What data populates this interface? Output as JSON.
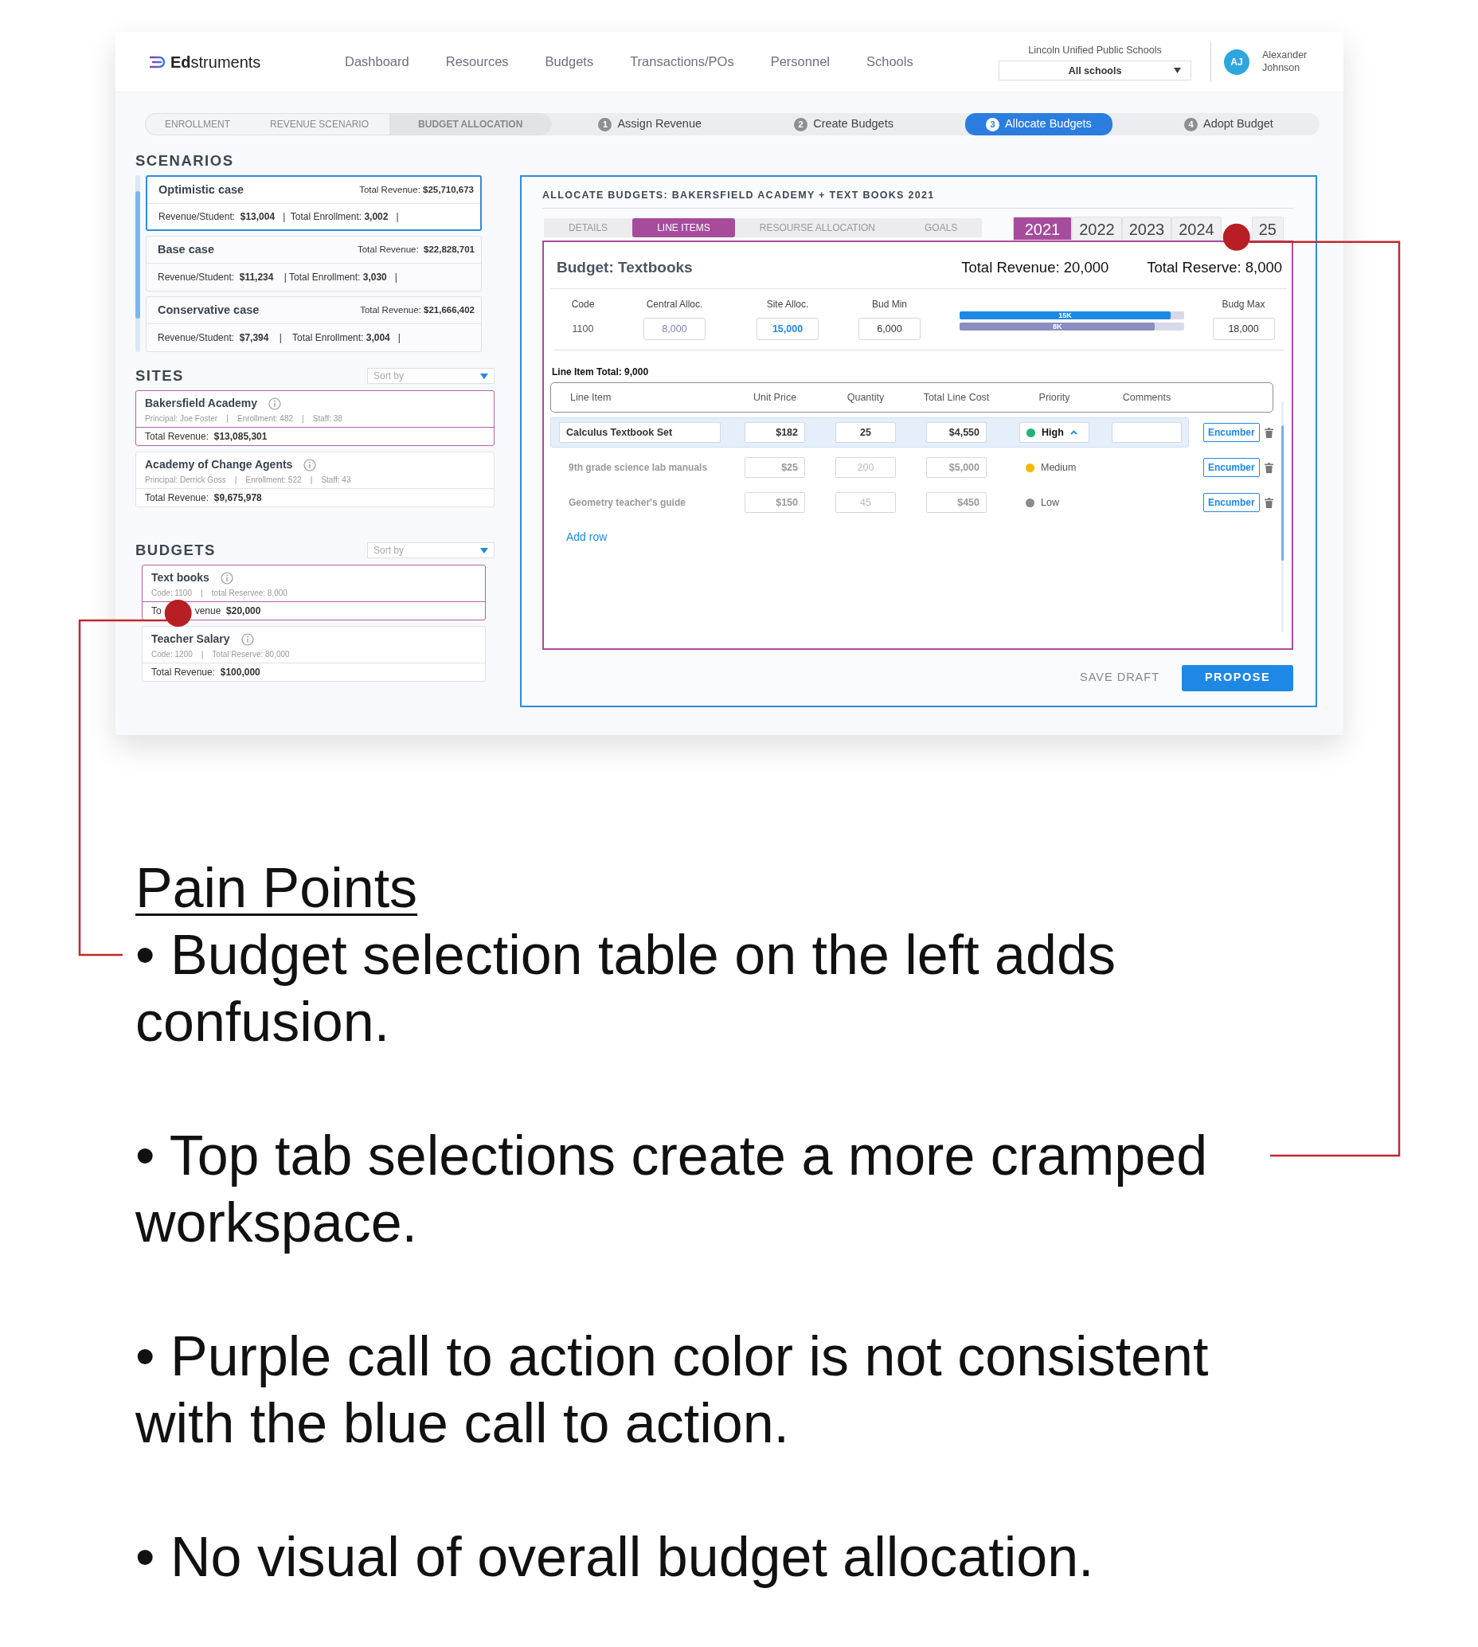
{
  "app": {
    "logo": "**Ed**struments",
    "nav": [
      "Dashboard",
      "Resources",
      "Budgets",
      "Transactions/POs",
      "Personnel",
      "Schools"
    ],
    "district": "Lincoln Unified Public Schools",
    "school_select": "All schools",
    "user": {
      "initials": "AJ",
      "name": "Alexander Johnson"
    }
  },
  "stepper": {
    "phases": [
      {
        "label": "ENROLLMENT",
        "selected": false
      },
      {
        "label": "REVENUE SCENARIO",
        "selected": false
      },
      {
        "label": "BUDGET ALLOCATION",
        "selected": true
      }
    ],
    "steps": [
      {
        "number": "1",
        "label": "Assign Revenue",
        "selected": false
      },
      {
        "number": "2",
        "label": "Create Budgets",
        "selected": false
      },
      {
        "number": "3",
        "label": "Allocate Budgets",
        "selected": true
      },
      {
        "number": "4",
        "label": "Adopt Budget",
        "selected": false
      }
    ]
  },
  "scenarios": {
    "title": "SCENARIOS",
    "items": [
      {
        "name": "Optimistic case",
        "total": "Total Revenue: **$25,710,673**",
        "details": "Revenue/Student:  **$13,004**   |  Total Enrollment: **3,002**   |",
        "selected": true
      },
      {
        "name": "Base case",
        "total": "Total Revenue:  **$22,828,701**",
        "details": "Revenue/Student:  **$11,234**    | Total Enrollment: **3,030**   |",
        "selected": false
      },
      {
        "name": "Conservative case",
        "total": "Total Revenue: **$21,666,402**",
        "details": "Revenue/Student:  **$7,394**    |    Total Enrollment: **3,004**   |",
        "selected": false
      }
    ]
  },
  "sites": {
    "title": "SITES",
    "sort_placeholder": "Sort by",
    "items": [
      {
        "name": "Bakersfield Academy",
        "meta": "Principal: Joe Foster    |    Enrollment: 482    |    Staff: 38",
        "revenue_parts": [
          "Total Revenue:  **$13,085,301**"
        ],
        "selected": true
      },
      {
        "name": "Academy of Change Agents",
        "meta": "Principal: Derrick Goss    |    Enrollment: 522    |    Staff: 43",
        "revenue_parts": [
          "Total Revenue:  **$9,675,978**"
        ],
        "selected": false
      }
    ]
  },
  "budgets": {
    "title": "BUDGETS",
    "sort_placeholder": "Sort by",
    "items": [
      {
        "name": "Text books",
        "meta": "Code: 1100    |    total Reservee: 8,000",
        "revenue_parts": [
          "To",
          "venue  **$20,000**"
        ],
        "selected": true
      },
      {
        "name": "Teacher Salary",
        "meta": "Code: 1200    |    Total Reserve: 80,000",
        "revenue_parts": [
          "Total Revenue:  **$100,000**"
        ],
        "selected": false
      }
    ]
  },
  "allocation": {
    "title": "ALLOCATE BUDGETS: BAKERSFIELD ACADEMY + TEXT BOOKS 2021",
    "tabs": [
      {
        "label": "DETAILS",
        "selected": false
      },
      {
        "label": "LINE ITEMS",
        "selected": true
      },
      {
        "label": "RESOURSE ALLOCATION",
        "selected": false
      },
      {
        "label": "GOALS",
        "selected": false
      }
    ],
    "years": [
      {
        "label": "2021",
        "selected": true
      },
      {
        "label": "2022",
        "selected": false
      },
      {
        "label": "2023",
        "selected": false
      },
      {
        "label": "2024",
        "selected": false
      },
      {
        "label": "25",
        "selected": false
      }
    ],
    "budget": {
      "title": "Budget: Textbooks",
      "total_revenue": "Total Revenue: 20,000",
      "total_reserve": "Total Reserve: 8,000",
      "code_label": "Code",
      "code": "1100",
      "central_label": "Central Alloc.",
      "central": "8,000",
      "site_label": "Site Alloc.",
      "site": "15,000",
      "min_label": "Bud Min",
      "min": "6,000",
      "max_label": "Budg Max",
      "max": "18,000",
      "bars": [
        {
          "label": "15K",
          "level": 0.94,
          "color": "#1e88e5"
        },
        {
          "label": "8K",
          "level": 0.87,
          "color": "#8a8fc2"
        }
      ]
    },
    "line_item_total": "Line Item Total: 9,000",
    "columns": [
      "Line Item",
      "Unit Price",
      "Quantity",
      "Total Line Cost",
      "Priority",
      "Comments"
    ],
    "rows": [
      {
        "item": "Calculus Textbook Set",
        "unit_price": "$182",
        "quantity": "25",
        "total": "$4,550",
        "priority": "High",
        "color": "#22b573",
        "action": "Encumber",
        "selected": true
      },
      {
        "item": "9th grade science lab manuals",
        "unit_price": "$25",
        "quantity": "200",
        "total": "$5,000",
        "priority": "Medium",
        "color": "#f5b800",
        "action": "Encumber",
        "selected": false
      },
      {
        "item": "Geometry teacher's guide",
        "unit_price": "$150",
        "quantity": "45",
        "total": "$450",
        "priority": "Low",
        "color": "#8c8c8c",
        "action": "Encumber",
        "selected": false
      }
    ],
    "add_row": "Add row",
    "save": "SAVE DRAFT",
    "propose": "PROPOSE"
  },
  "notes": {
    "title": "Pain Points",
    "items": [
      "• Budget selection table on the left adds confusion.",
      "• Top tab selections create a more cramped workspace.",
      "• Purple call to action color is not consistent with the blue call to action.",
      "• No visual of overall budget allocation."
    ]
  }
}
